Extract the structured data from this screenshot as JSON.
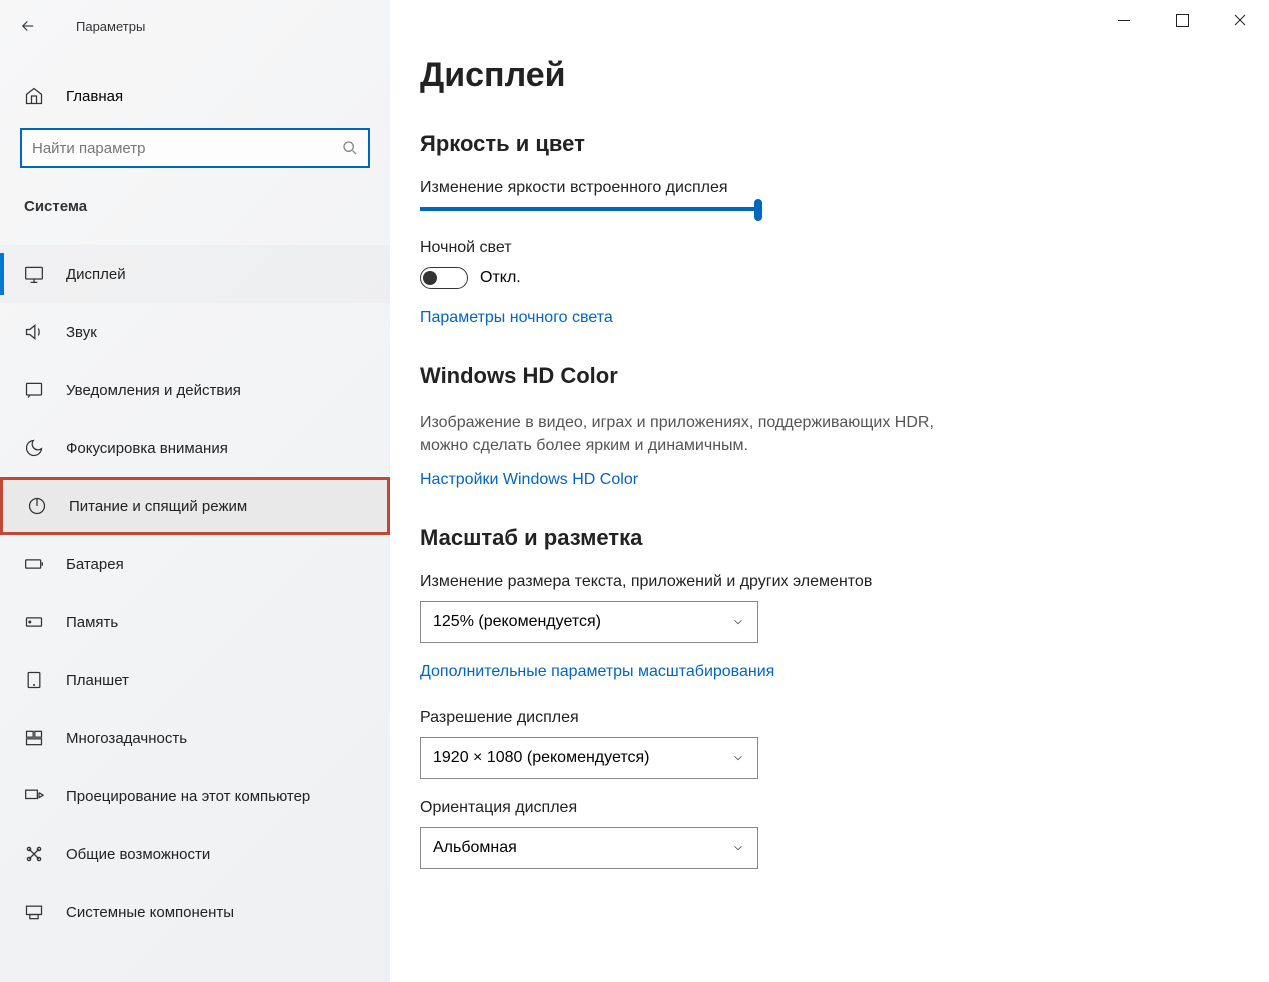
{
  "window": {
    "title": "Параметры"
  },
  "sidebar": {
    "home": "Главная",
    "search_placeholder": "Найти параметр",
    "section": "Система",
    "items": [
      {
        "label": "Дисплей",
        "icon": "display"
      },
      {
        "label": "Звук",
        "icon": "sound"
      },
      {
        "label": "Уведомления и действия",
        "icon": "notifications"
      },
      {
        "label": "Фокусировка внимания",
        "icon": "focus"
      },
      {
        "label": "Питание и спящий режим",
        "icon": "power"
      },
      {
        "label": "Батарея",
        "icon": "battery"
      },
      {
        "label": "Память",
        "icon": "storage"
      },
      {
        "label": "Планшет",
        "icon": "tablet"
      },
      {
        "label": "Многозадачность",
        "icon": "multitask"
      },
      {
        "label": "Проецирование на этот компьютер",
        "icon": "project"
      },
      {
        "label": "Общие возможности",
        "icon": "shared"
      },
      {
        "label": "Системные компоненты",
        "icon": "components"
      }
    ]
  },
  "main": {
    "title": "Дисплей",
    "groups": {
      "brightness": {
        "heading": "Яркость и цвет",
        "brightness_label": "Изменение яркости встроенного дисплея",
        "nightlight_label": "Ночной свет",
        "toggle_state": "Откл.",
        "nightlight_link": "Параметры ночного света"
      },
      "hdcolor": {
        "heading": "Windows HD Color",
        "desc": "Изображение в видео, играх и приложениях, поддерживающих HDR, можно сделать более ярким и динамичным.",
        "link": "Настройки Windows HD Color"
      },
      "scale": {
        "heading": "Масштаб и разметка",
        "scale_label": "Изменение размера текста, приложений и других элементов",
        "scale_value": "125% (рекомендуется)",
        "scale_link": "Дополнительные параметры масштабирования",
        "resolution_label": "Разрешение дисплея",
        "resolution_value": "1920 × 1080 (рекомендуется)",
        "orientation_label": "Ориентация дисплея",
        "orientation_value": "Альбомная"
      }
    }
  }
}
